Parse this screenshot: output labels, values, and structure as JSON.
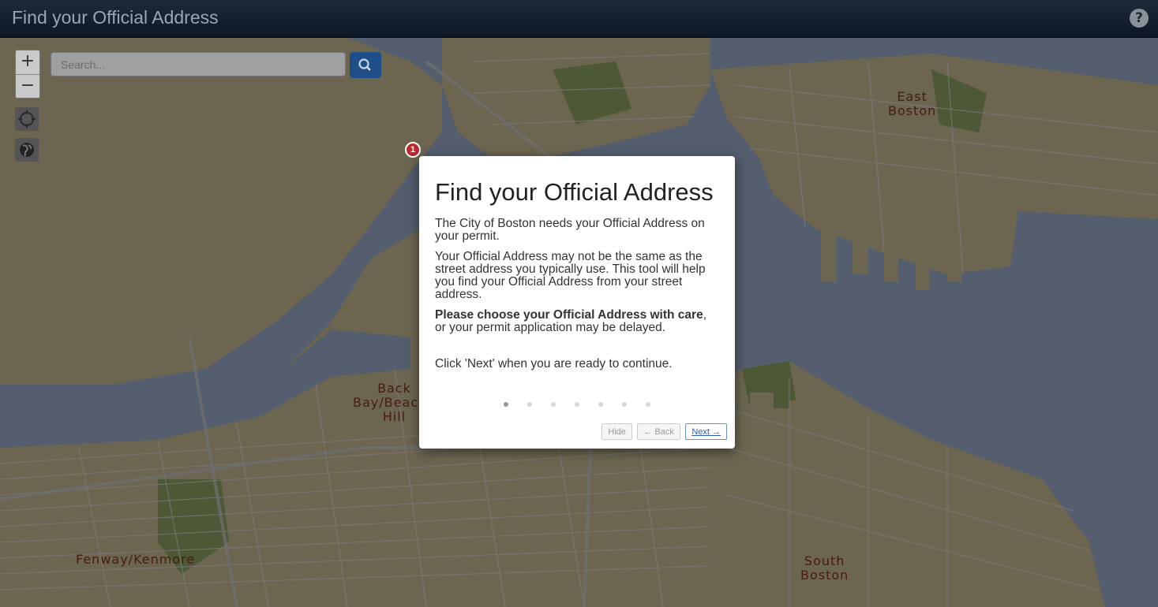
{
  "header": {
    "title": "Find your Official Address",
    "help_glyph": "?"
  },
  "map": {
    "zoom_in": "+",
    "zoom_out": "−",
    "search_placeholder": "Search...",
    "labels": {
      "east_boston": "East\nBoston",
      "back_bay": "Back\nBay/Beacon\nHill",
      "fenway": "Fenway/Kenmore",
      "south_boston": "South\nBoston"
    },
    "tour_marker": "1",
    "colors": {
      "land": "#d9cda0",
      "water": "#a9bddf",
      "park": "#9ab06c",
      "road": "#f2f2f2"
    }
  },
  "modal": {
    "title": "Find your Official Address",
    "p1": "The City of Boston needs your Official Address on your permit.",
    "p2": "Your Official Address may not be the same as the street address you typically use. This tool will help you find your Official Address from your street address.",
    "p3_bold": "Please choose your Official Address with care",
    "p3_rest": ", or your permit application may be delayed.",
    "p4": "Click 'Next' when you are ready to continue.",
    "steps_total": 7,
    "step_current": 1,
    "hide_label": "Hide",
    "back_label": "← Back",
    "next_label": "Next →"
  }
}
